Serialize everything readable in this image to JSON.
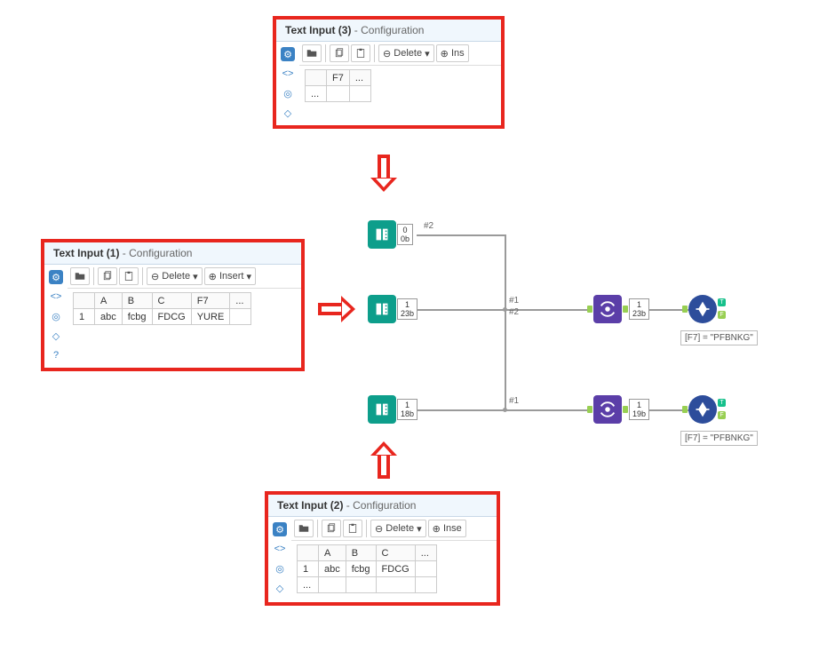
{
  "panels": {
    "p3": {
      "title": "Text Input (3)",
      "subtitle": " - Configuration",
      "toolbar": {
        "delete": "Delete",
        "insert": "Ins"
      },
      "table": {
        "headers": [
          "",
          "F7",
          "..."
        ],
        "rows": [
          [
            "...",
            "",
            ""
          ]
        ]
      }
    },
    "p1": {
      "title": "Text Input (1)",
      "subtitle": " - Configuration",
      "toolbar": {
        "delete": "Delete",
        "insert": "Insert"
      },
      "table": {
        "headers": [
          "",
          "A",
          "B",
          "C",
          "F7",
          "..."
        ],
        "rows": [
          [
            "1",
            "abc",
            "fcbg",
            "FDCG",
            "YURE",
            ""
          ]
        ]
      }
    },
    "p2": {
      "title": "Text Input (2)",
      "subtitle": " - Configuration",
      "toolbar": {
        "delete": "Delete",
        "insert": "Inse"
      },
      "table": {
        "headers": [
          "",
          "A",
          "B",
          "C",
          "..."
        ],
        "rows": [
          [
            "1",
            "abc",
            "fcbg",
            "FDCG",
            ""
          ],
          [
            "...",
            "",
            "",
            "",
            ""
          ]
        ]
      }
    }
  },
  "canvas": {
    "nodes": {
      "in_top": {
        "stats": {
          "rows": "0",
          "bytes": "0b"
        }
      },
      "in_mid": {
        "stats": {
          "rows": "1",
          "bytes": "23b"
        }
      },
      "in_bot": {
        "stats": {
          "rows": "1",
          "bytes": "18b"
        }
      },
      "union_top": {
        "stats": {
          "rows": "1",
          "bytes": "23b"
        }
      },
      "union_bot": {
        "stats": {
          "rows": "1",
          "bytes": "19b"
        }
      }
    },
    "labels": {
      "top": "#2",
      "mid_a": "#1",
      "mid_b": "#2",
      "bot": "#1"
    },
    "annotations": {
      "filter1": "[F7] = \"PFBNKG\"",
      "filter2": "[F7] = \"PFBNKG\""
    }
  },
  "glyphs": {
    "minus": "⊖",
    "plus": "⊕",
    "dropdown": "▾"
  }
}
